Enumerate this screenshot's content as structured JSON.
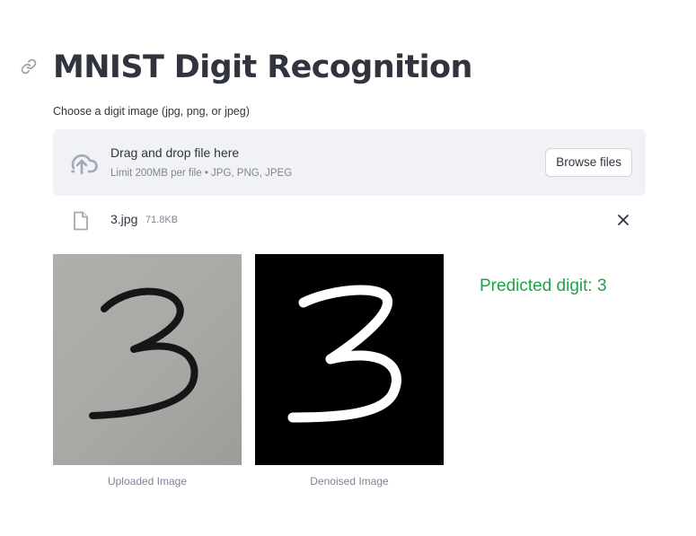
{
  "header": {
    "title": "MNIST Digit Recognition"
  },
  "uploader": {
    "label": "Choose a digit image (jpg, png, or jpeg)",
    "drop_title": "Drag and drop file here",
    "drop_limit": "Limit 200MB per file • JPG, PNG, JPEG",
    "browse_label": "Browse files",
    "icon": "cloud-upload-icon"
  },
  "file": {
    "name": "3.jpg",
    "size": "71.8KB",
    "icon": "file-icon",
    "remove_icon": "close-icon"
  },
  "images": {
    "uploaded_caption": "Uploaded Image",
    "denoised_caption": "Denoised Image"
  },
  "result": {
    "prediction": "Predicted digit: 3",
    "color": "#21a148"
  },
  "colors": {
    "text": "#31333f",
    "muted": "#808495",
    "dropzone_bg": "#f0f2f6"
  }
}
